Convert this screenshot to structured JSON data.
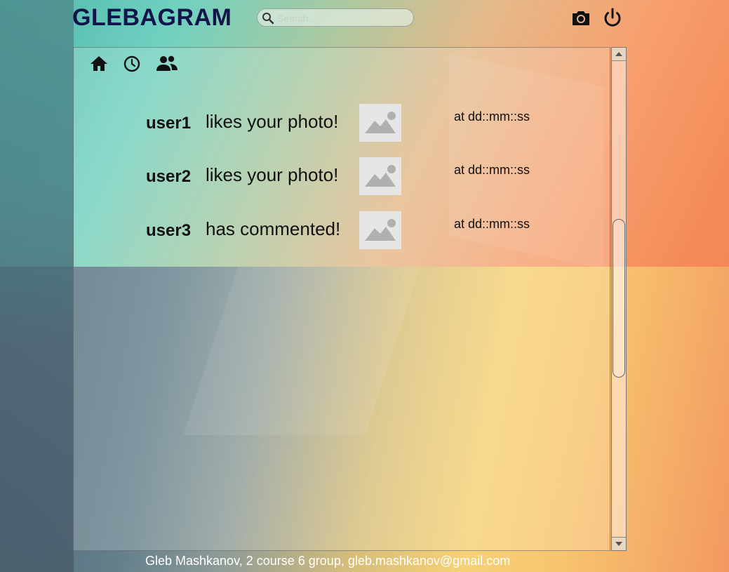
{
  "app": {
    "title": "GLEBAGRAM"
  },
  "search": {
    "placeholder": "Search..."
  },
  "header": {
    "camera_icon": "camera-icon",
    "power_icon": "power-icon"
  },
  "nav": {
    "icons": [
      "home-icon",
      "clock-icon",
      "people-icon"
    ]
  },
  "notifications": [
    {
      "user": "user1",
      "action": "likes your photo!",
      "time": "at dd::mm::ss"
    },
    {
      "user": "user2",
      "action": "likes your photo!",
      "time": "at dd::mm::ss"
    },
    {
      "user": "user3",
      "action": "has commented!",
      "time": "at dd::mm::ss"
    }
  ],
  "footer": {
    "text": "Gleb Mashkanov, 2 course 6 group, gleb.mashkanov@gmail.com"
  },
  "colors": {
    "logo": "#11154a",
    "thumb_bg": "#e6e6e6",
    "thumb_icon": "#b0b0b0"
  }
}
